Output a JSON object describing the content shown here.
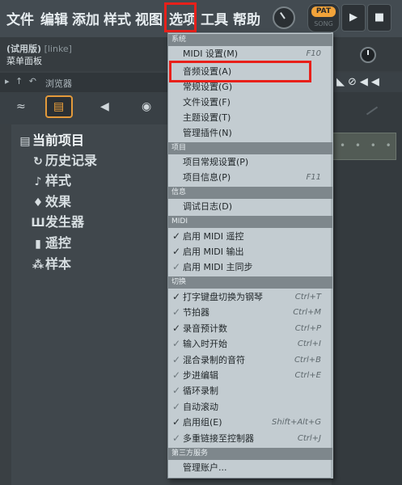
{
  "menubar": {
    "items": [
      "文件",
      "编辑",
      "添加",
      "样式",
      "视图",
      "选项",
      "工具",
      "帮助"
    ],
    "pat_label": "PAT",
    "song_label": "SONG",
    "play_icon": "play-icon",
    "stop_icon": "stop-icon"
  },
  "hint": {
    "mode": "(试用版)",
    "user": "[linke]",
    "text": "菜单面板"
  },
  "browser": {
    "title": "浏览器",
    "tree": [
      {
        "label": "当前项目",
        "icon": "project-icon"
      },
      {
        "label": "历史记录",
        "icon": "history-icon"
      },
      {
        "label": "样式",
        "icon": "note-icon"
      },
      {
        "label": "效果",
        "icon": "effect-icon"
      },
      {
        "label": "发生器",
        "icon": "generator-icon"
      },
      {
        "label": "遥控",
        "icon": "remote-icon"
      },
      {
        "label": "样本",
        "icon": "sample-icon"
      }
    ]
  },
  "dropdown": {
    "sections": {
      "system": "系统",
      "project": "项目",
      "info": "信息",
      "midi": "MIDI",
      "toggle": "切换",
      "thirdparty": "第三方服务"
    },
    "items": {
      "midi_settings": {
        "label": "MIDI 设置(M)",
        "shortcut": "F10"
      },
      "audio_settings": {
        "label": "音频设置(A)"
      },
      "general_settings": {
        "label": "常规设置(G)"
      },
      "file_settings": {
        "label": "文件设置(F)"
      },
      "theme_settings": {
        "label": "主题设置(T)"
      },
      "manage_plugins": {
        "label": "管理插件(N)"
      },
      "project_general": {
        "label": "项目常规设置(P)"
      },
      "project_info": {
        "label": "项目信息(P)",
        "shortcut": "F11"
      },
      "debug_log": {
        "label": "调试日志(D)"
      },
      "midi_remote": {
        "label": "启用 MIDI 遥控",
        "checked": true
      },
      "midi_output": {
        "label": "启用 MIDI 输出",
        "checked": true
      },
      "midi_sync": {
        "label": "启用 MIDI 主同步",
        "checked": true
      },
      "typing_keyboard": {
        "label": "打字键盘切换为钢琴",
        "shortcut": "Ctrl+T",
        "checked": true
      },
      "metronome": {
        "label": "节拍器",
        "shortcut": "Ctrl+M",
        "checked": true
      },
      "count_in": {
        "label": "录音预计数",
        "shortcut": "Ctrl+P",
        "checked": true
      },
      "start_on_input": {
        "label": "输入时开始",
        "shortcut": "Ctrl+I",
        "checked": true
      },
      "blend_notes": {
        "label": "混合录制的音符",
        "shortcut": "Ctrl+B",
        "checked": true
      },
      "step_edit": {
        "label": "步进编辑",
        "shortcut": "Ctrl+E",
        "checked": true
      },
      "loop_record": {
        "label": "循环录制",
        "checked": true
      },
      "auto_scroll": {
        "label": "自动滚动",
        "checked": true
      },
      "enable_groups": {
        "label": "启用组(E)",
        "shortcut": "Shift+Alt+G",
        "checked": true
      },
      "multilink": {
        "label": "多重链接至控制器",
        "shortcut": "Ctrl+J",
        "checked": true
      },
      "manage_account": {
        "label": "管理账户..."
      }
    }
  }
}
